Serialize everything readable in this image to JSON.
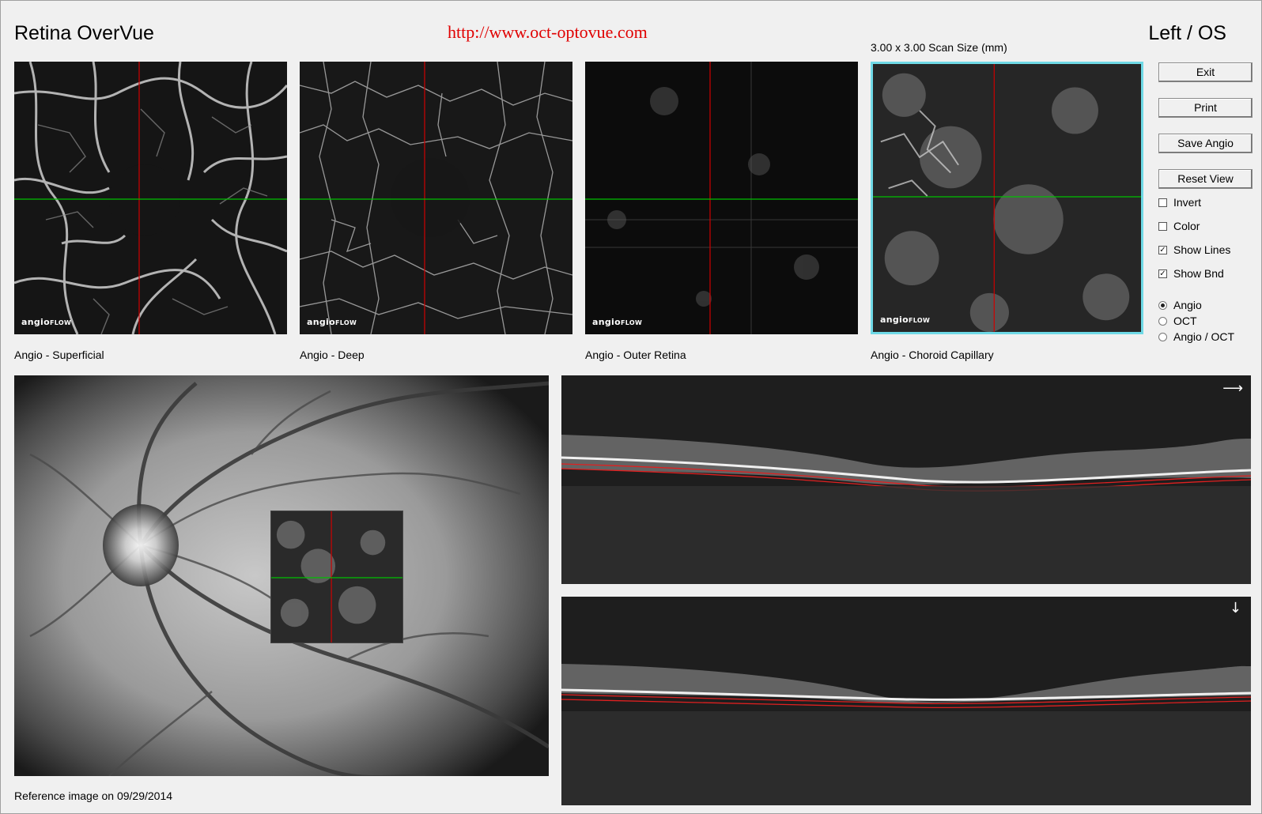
{
  "header": {
    "title": "Retina OverVue",
    "url": "http://www.oct-optovue.com",
    "eye": "Left / OS",
    "scan_size": "3.00 x 3.00 Scan Size (mm)"
  },
  "thumbnails": [
    {
      "label": "Angio - Superficial",
      "logo": "angio",
      "logo_small": "FLOW"
    },
    {
      "label": "Angio - Deep",
      "logo": "angio",
      "logo_small": "FLOW"
    },
    {
      "label": "Angio - Outer Retina",
      "logo": "angio",
      "logo_small": "FLOW"
    },
    {
      "label": "Angio - Choroid Capillary",
      "logo": "angio",
      "logo_small": "FLOW"
    }
  ],
  "controls": {
    "buttons": {
      "exit": "Exit",
      "print": "Print",
      "save_angio": "Save Angio",
      "reset_view": "Reset View"
    },
    "checkboxes": [
      {
        "label": "Invert",
        "checked": false
      },
      {
        "label": "Color",
        "checked": false
      },
      {
        "label": "Show Lines",
        "checked": true
      },
      {
        "label": "Show Bnd",
        "checked": true
      }
    ],
    "radios": [
      {
        "label": "Angio",
        "selected": true
      },
      {
        "label": "OCT",
        "selected": false
      },
      {
        "label": "Angio / OCT",
        "selected": false
      }
    ],
    "check_mark": "✓"
  },
  "reference": {
    "label": "Reference image on 09/29/2014"
  },
  "bscans": {
    "top_arrow": "⟶",
    "bottom_arrow": "↓"
  },
  "colors": {
    "selected_border": "#6fd9e6",
    "crosshair_vertical": "#d00000",
    "crosshair_horizontal": "#00c000",
    "url_text": "#e00000",
    "boundary_line": "#e02020"
  }
}
